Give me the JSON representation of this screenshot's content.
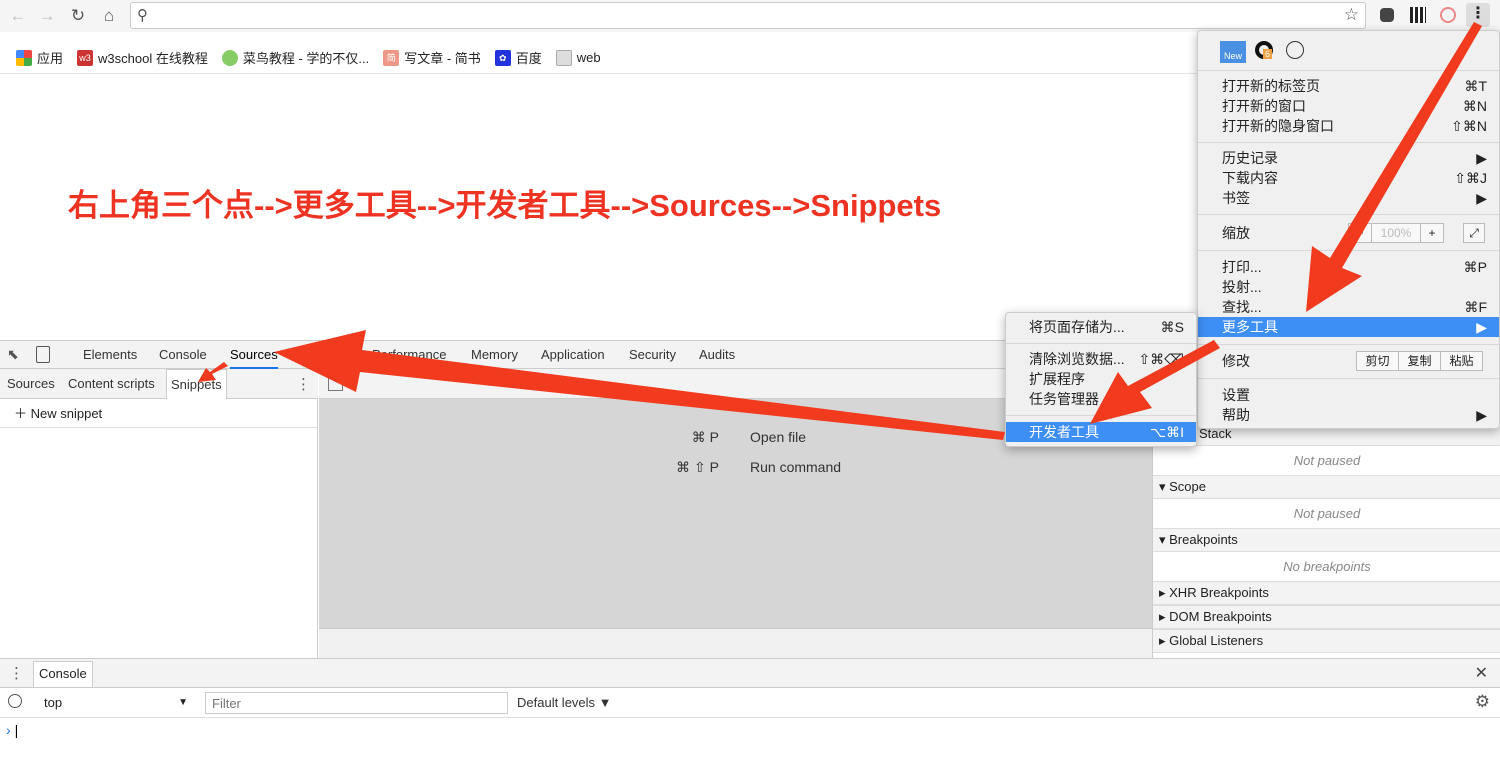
{
  "browser": {
    "omnibox_value": "",
    "bookmarks": [
      {
        "label": "应用",
        "icon": "apps-grid-icon"
      },
      {
        "label": "w3school 在线教程",
        "icon": "w3school-icon"
      },
      {
        "label": "菜鸟教程 - 学的不仅...",
        "icon": "runoob-icon"
      },
      {
        "label": "写文章 - 简书",
        "icon": "jianshu-icon"
      },
      {
        "label": "百度",
        "icon": "baidu-paw-icon"
      },
      {
        "label": "web",
        "icon": "folder-icon"
      }
    ]
  },
  "annotation": "右上角三个点-->更多工具-->开发者工具-->Sources-->Snippets",
  "devtools": {
    "tabs": [
      "Elements",
      "Console",
      "Sources",
      "Network",
      "Performance",
      "Memory",
      "Application",
      "Security",
      "Audits"
    ],
    "active_tab": "Sources",
    "sub_tabs": [
      "Sources",
      "Content scripts",
      "Snippets"
    ],
    "active_sub_tab": "Snippets",
    "new_snippet": "New snippet",
    "commands": [
      {
        "keys": "⌘ P",
        "label": "Open file"
      },
      {
        "keys": "⌘ ⇧ P",
        "label": "Run command"
      }
    ],
    "right": {
      "call_stack": "Stack",
      "not_paused": "Not paused",
      "scope": "Scope",
      "breakpoints": "Breakpoints",
      "no_breakpoints": "No breakpoints",
      "xhr": "XHR Breakpoints",
      "dom": "DOM Breakpoints",
      "global": "Global Listeners"
    },
    "drawer": {
      "tab": "Console",
      "context": "top",
      "filter_placeholder": "Filter",
      "levels": "Default levels ▼"
    }
  },
  "menu": {
    "extension_badges": {
      "new": "New",
      "count": "6"
    },
    "items": [
      {
        "label": "打开新的标签页",
        "shortcut": "⌘T"
      },
      {
        "label": "打开新的窗口",
        "shortcut": "⌘N"
      },
      {
        "label": "打开新的隐身窗口",
        "shortcut": "⇧⌘N"
      },
      {
        "label": "历史记录",
        "shortcut": "▶"
      },
      {
        "label": "下载内容",
        "shortcut": "⇧⌘J"
      },
      {
        "label": "书签",
        "shortcut": "▶"
      },
      {
        "label": "缩放",
        "shortcut": ""
      },
      {
        "label": "打印...",
        "shortcut": "⌘P"
      },
      {
        "label": "投射...",
        "shortcut": ""
      },
      {
        "label": "查找...",
        "shortcut": "⌘F"
      },
      {
        "label": "更多工具",
        "shortcut": "▶"
      },
      {
        "label": "修改",
        "shortcut": ""
      },
      {
        "label": "设置",
        "shortcut": ""
      },
      {
        "label": "帮助",
        "shortcut": "▶"
      }
    ],
    "zoom_level": "100%",
    "edit_buttons": [
      "剪切",
      "复制",
      "粘贴"
    ]
  },
  "submenu": {
    "items": [
      {
        "label": "将页面存储为...",
        "shortcut": "⌘S"
      },
      {
        "label": "清除浏览数据...",
        "shortcut": "⇧⌘⌫"
      },
      {
        "label": "扩展程序",
        "shortcut": ""
      },
      {
        "label": "任务管理器",
        "shortcut": ""
      },
      {
        "label": "开发者工具",
        "shortcut": "⌥⌘I"
      }
    ]
  },
  "colors": {
    "highlight": "#3d8ef5",
    "annotation": "#ee3322",
    "arrow": "#f23a1e"
  }
}
